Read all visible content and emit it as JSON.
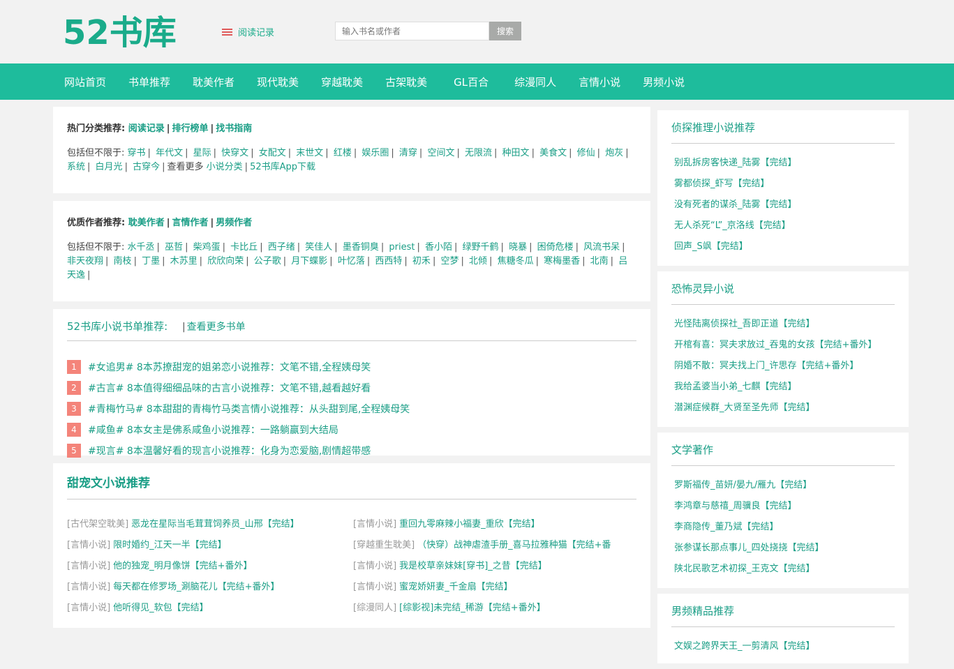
{
  "header": {
    "logo": "52书库",
    "history_label": "阅读记录",
    "search_placeholder": "输入书名或作者",
    "search_button": "搜索"
  },
  "nav": [
    "网站首页",
    "书单推荐",
    "耽美作者",
    "现代耽美",
    "穿越耽美",
    "古架耽美",
    "GL百合",
    "综漫同人",
    "言情小说",
    "男频小说"
  ],
  "hot": {
    "title": "热门分类推荐:",
    "links": [
      "阅读记录",
      "排行榜单",
      "找书指南"
    ],
    "prefix": "包括但不限于:",
    "tags": [
      "穿书",
      "年代文",
      "星际",
      "快穿文",
      "女配文",
      "末世文",
      "红楼",
      "娱乐圈",
      "清穿",
      "空间文",
      "无限流",
      "种田文",
      "美食文",
      "修仙",
      "炮灰",
      "系统",
      "白月光",
      "古穿今"
    ],
    "more_prefix": "查看更多",
    "more_links": [
      "小说分类",
      "52书库App下载"
    ]
  },
  "authors": {
    "title": "优质作者推荐:",
    "links": [
      "耽美作者",
      "言情作者",
      "男频作者"
    ],
    "prefix": "包括但不限于:",
    "names": [
      "水千丞",
      "巫哲",
      "柴鸡蛋",
      "卡比丘",
      "西子绪",
      "笑佳人",
      "墨香铜臭",
      "priest",
      "香小陌",
      "绿野千鹤",
      "晓暴",
      "困倚危楼",
      "风流书呆",
      "非天夜翔",
      "南枝",
      "丁墨",
      "木苏里",
      "欣欣向荣",
      "公子歌",
      "月下蝶影",
      "叶忆落",
      "西西特",
      "初禾",
      "空梦",
      "北倾",
      "焦糖冬瓜",
      "寒梅墨香",
      "北南",
      "吕天逸"
    ]
  },
  "booklist": {
    "title": "52书库小说书单推荐:",
    "more": "查看更多书单",
    "items": [
      {
        "num": "1",
        "text": "#女追男# 8本苏撩甜宠的姐弟恋小说推荐：文笔不错,全程姨母笑"
      },
      {
        "num": "2",
        "text": "#古言# 8本值得细细品味的古言小说推荐：文笔不错,越看越好看"
      },
      {
        "num": "3",
        "text": "#青梅竹马# 8本甜甜的青梅竹马类言情小说推荐：从头甜到尾,全程姨母笑"
      },
      {
        "num": "4",
        "text": "#咸鱼# 8本女主是佛系咸鱼小说推荐：一路躺赢到大结局"
      },
      {
        "num": "5",
        "text": "#现言# 8本温馨好看的现言小说推荐：化身为恋爱脑,剧情超带感"
      }
    ]
  },
  "sweet": {
    "title": "甜宠文小说推荐",
    "items": [
      {
        "cat": "[古代架空耽美]",
        "title": "恶龙在星际当毛茸茸饲养员_山邢【完结】"
      },
      {
        "cat": "[言情小说]",
        "title": "重回九零麻辣小福妻_重欣【完结】"
      },
      {
        "cat": "[言情小说]",
        "title": "限时婚约_江天一半【完结】"
      },
      {
        "cat": "[穿越重生耽美]",
        "title": "（快穿）战神虐渣手册_喜马拉雅种猫【完结+番"
      },
      {
        "cat": "[言情小说]",
        "title": "他的独宠_明月像饼【完结+番外】"
      },
      {
        "cat": "[言情小说]",
        "title": "我是校草亲妹妹[穿书]_之昔【完结】"
      },
      {
        "cat": "[言情小说]",
        "title": "每天都在修罗场_涮脑花儿【完结+番外】"
      },
      {
        "cat": "[言情小说]",
        "title": "蜜宠娇妍妻_千金扇【完结】"
      },
      {
        "cat": "[言情小说]",
        "title": "他听得见_软包【完结】"
      },
      {
        "cat": "[综漫同人]",
        "title": "[综影视]未完结_稀游【完结+番外】"
      }
    ]
  },
  "sidebar": [
    {
      "title": "侦探推理小说推荐",
      "items": [
        "别乱拆房客快递_陆雾【完结】",
        "雾都侦探_虾写【完结】",
        "没有死者的谋杀_陆雾【完结】",
        "无人杀死“L”_京洛线【完结】",
        "回声_S飒【完结】"
      ]
    },
    {
      "title": "恐怖灵异小说",
      "items": [
        "光怪陆离侦探社_吾即正道【完结】",
        "开棺有喜：冥夫求放过_吞鬼的女孩【完结+番外】",
        "阴婚不散：冥夫找上门_许思存【完结+番外】",
        "我给孟婆当小弟_七麒【完结】",
        "潜渊症候群_大贤至圣先师【完结】"
      ]
    },
    {
      "title": "文学著作",
      "items": [
        "罗斯福传_苗妍/晏九/雁九【完结】",
        "李鸿章与慈禧_周骥良【完结】",
        "李商隐传_董乃斌【完结】",
        "张参谋长那点事儿_四处挠挠【完结】",
        "陕北民歌艺术初探_王克文【完结】"
      ]
    },
    {
      "title": "男频精品推荐",
      "items": [
        "文娱之跨界天王_一剪清风【完结】"
      ]
    }
  ]
}
